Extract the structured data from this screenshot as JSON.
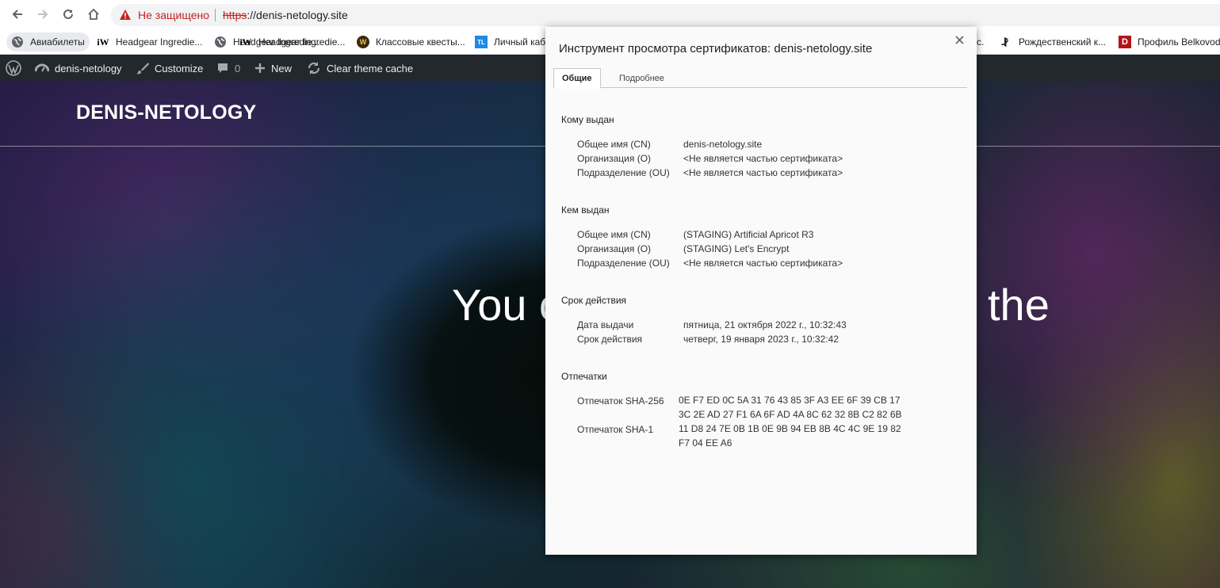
{
  "browser": {
    "security_label": "Не защищено",
    "url_scheme": "https",
    "url_rest": "://denis-netology.site"
  },
  "bookmarks": [
    {
      "label": "Авиабилеты",
      "icon": "globe-icon"
    },
    {
      "label": "Headgear Ingredie...",
      "icon": "iw-icon"
    },
    {
      "label": "Headgear Ingredie...",
      "icon": "globe-icon"
    },
    {
      "label": "Headgear Ingredie...",
      "icon": "iw-icon"
    },
    {
      "label": "Классовые квесты...",
      "icon": "wow-icon"
    },
    {
      "label": "Личный каб",
      "icon": "tl-icon"
    },
    {
      "label": "Рождественский к...",
      "icon": "playstation-icon"
    },
    {
      "label": "Профиль Belkovod",
      "icon": "d-icon"
    }
  ],
  "bookmark_icon_texts": {
    "iw": "iW",
    "tl": "TL",
    "d": "D",
    "wow": "W",
    "cut": "с."
  },
  "wpbar": {
    "site": "denis-netology",
    "customize": "Customize",
    "comments": "0",
    "new": "New",
    "cache": "Clear theme cache"
  },
  "hero": {
    "site_title": "DENIS-NETOLOGY",
    "text_left": "You c",
    "text_right": "the"
  },
  "dialog": {
    "title": "Инструмент просмотра сертификатов: denis-netology.site",
    "tabs": [
      "Общие",
      "Подробнее"
    ],
    "issued_to": {
      "heading": "Кому выдан",
      "fields": [
        {
          "label": "Общее имя (CN)",
          "value": "denis-netology.site"
        },
        {
          "label": "Организация (O)",
          "value": "<Не является частью сертификата>"
        },
        {
          "label": "Подразделение (OU)",
          "value": "<Не является частью сертификата>"
        }
      ]
    },
    "issued_by": {
      "heading": "Кем выдан",
      "fields": [
        {
          "label": "Общее имя (CN)",
          "value": "(STAGING) Artificial Apricot R3"
        },
        {
          "label": "Организация (O)",
          "value": "(STAGING) Let's Encrypt"
        },
        {
          "label": "Подразделение (OU)",
          "value": "<Не является частью сертификата>"
        }
      ]
    },
    "validity": {
      "heading": "Срок действия",
      "fields": [
        {
          "label": "Дата выдачи",
          "value": "пятница, 21 октября 2022 г., 10:32:43"
        },
        {
          "label": "Срок действия",
          "value": "четверг, 19 января 2023 г., 10:32:42"
        }
      ]
    },
    "fingerprints": {
      "heading": "Отпечатки",
      "sha256_label": "Отпечаток SHA-256",
      "sha256_line1": "0E F7 ED 0C 5A 31 76 43 85 3F A3 EE 6F 39 CB 17",
      "sha256_line2": "3C 2E AD 27 F1 6A 6F AD 4A 8C 62 32 8B C2 82 6B",
      "sha1_label": "Отпечаток SHA-1",
      "sha1_line1": "11 D8 24 7E 0B 1B 0E 9B 94 EB 8B 4C 4C 9E 19 82",
      "sha1_line2": "F7 04 EE A6"
    }
  }
}
